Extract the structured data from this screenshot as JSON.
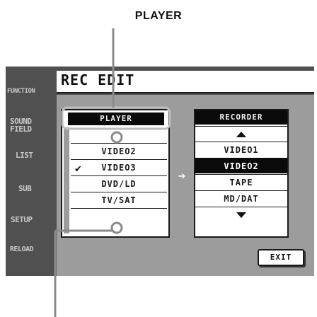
{
  "callout": {
    "title": "PLAYER"
  },
  "sidebar": {
    "items": [
      {
        "label": "FUNCTION"
      },
      {
        "label": "SOUND\nFIELD"
      },
      {
        "label": "LIST"
      },
      {
        "label": "SUB"
      },
      {
        "label": "SETUP"
      },
      {
        "label": "RELOAD"
      }
    ]
  },
  "header": {
    "title": "REC EDIT"
  },
  "player": {
    "header": "PLAYER",
    "items": [
      "VIDEO2",
      "VIDEO3",
      "DVD/LD",
      "TV/SAT"
    ],
    "checked_item": "VIDEO3"
  },
  "recorder": {
    "header": "RECORDER",
    "items": [
      "VIDEO1",
      "VIDEO2",
      "TAPE",
      "MD/DAT"
    ],
    "selected_item": "VIDEO2"
  },
  "exit_label": "EXIT",
  "icons": {
    "check": "check-icon",
    "arrow": "arrow-right-icon",
    "up": "scroll-up-icon",
    "down": "scroll-down-icon"
  }
}
